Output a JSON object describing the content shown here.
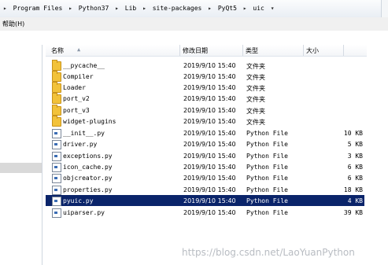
{
  "breadcrumb": [
    "Program Files",
    "Python37",
    "Lib",
    "site-packages",
    "PyQt5",
    "uic"
  ],
  "breadcrumb_sep": "▸",
  "breadcrumb_lead": "▸",
  "breadcrumb_trail": "▾",
  "menu": {
    "help": "帮助(H)"
  },
  "columns": {
    "name": "名称",
    "date": "修改日期",
    "type": "类型",
    "size": "大小"
  },
  "files": [
    {
      "name": "__pycache__",
      "date": "2019/9/10 15:40",
      "type": "文件夹",
      "size": "",
      "kind": "folder"
    },
    {
      "name": "Compiler",
      "date": "2019/9/10 15:40",
      "type": "文件夹",
      "size": "",
      "kind": "folder"
    },
    {
      "name": "Loader",
      "date": "2019/9/10 15:40",
      "type": "文件夹",
      "size": "",
      "kind": "folder"
    },
    {
      "name": "port_v2",
      "date": "2019/9/10 15:40",
      "type": "文件夹",
      "size": "",
      "kind": "folder"
    },
    {
      "name": "port_v3",
      "date": "2019/9/10 15:40",
      "type": "文件夹",
      "size": "",
      "kind": "folder"
    },
    {
      "name": "widget-plugins",
      "date": "2019/9/10 15:40",
      "type": "文件夹",
      "size": "",
      "kind": "folder"
    },
    {
      "name": "__init__.py",
      "date": "2019/9/10 15:40",
      "type": "Python File",
      "size": "10 KB",
      "kind": "file"
    },
    {
      "name": "driver.py",
      "date": "2019/9/10 15:40",
      "type": "Python File",
      "size": "5 KB",
      "kind": "file"
    },
    {
      "name": "exceptions.py",
      "date": "2019/9/10 15:40",
      "type": "Python File",
      "size": "3 KB",
      "kind": "file"
    },
    {
      "name": "icon_cache.py",
      "date": "2019/9/10 15:40",
      "type": "Python File",
      "size": "6 KB",
      "kind": "file"
    },
    {
      "name": "objcreator.py",
      "date": "2019/9/10 15:40",
      "type": "Python File",
      "size": "6 KB",
      "kind": "file"
    },
    {
      "name": "properties.py",
      "date": "2019/9/10 15:40",
      "type": "Python File",
      "size": "18 KB",
      "kind": "file"
    },
    {
      "name": "pyuic.py",
      "date": "2019/9/10 15:40",
      "type": "Python File",
      "size": "4 KB",
      "kind": "file",
      "selected": true
    },
    {
      "name": "uiparser.py",
      "date": "2019/9/10 15:40",
      "type": "Python File",
      "size": "39 KB",
      "kind": "file"
    }
  ],
  "watermark": "https://blog.csdn.net/LaoYuanPython",
  "colors": {
    "selection": "#0a246a",
    "folder": "#f2c23a"
  }
}
